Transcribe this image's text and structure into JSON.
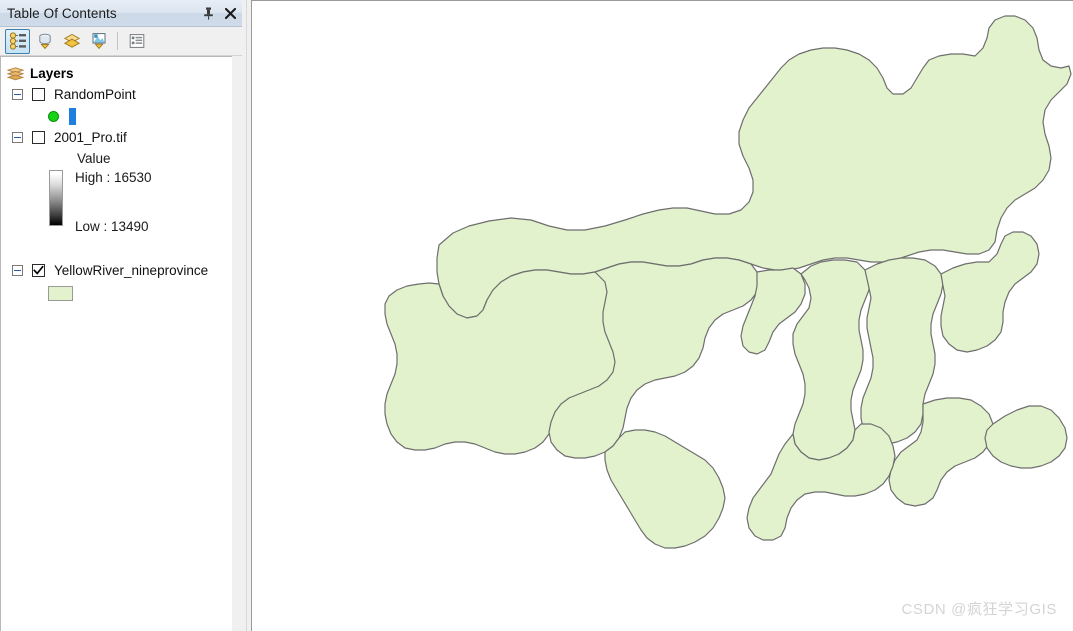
{
  "panel": {
    "title": "Table Of Contents",
    "title_buttons": [
      {
        "name": "auto-hide-pin",
        "icon": "pin-icon",
        "tooltip": "Auto Hide"
      },
      {
        "name": "close",
        "icon": "close-icon",
        "tooltip": "Close"
      }
    ],
    "toolbar": [
      {
        "name": "list-by-drawing-order",
        "icon": "list-by-drawing-order-icon",
        "active": true
      },
      {
        "name": "list-by-source",
        "icon": "list-by-source-icon",
        "active": false
      },
      {
        "name": "list-by-visibility",
        "icon": "list-by-visibility-icon",
        "active": false
      },
      {
        "name": "list-by-selection",
        "icon": "list-by-selection-icon",
        "active": false
      },
      {
        "name": "options",
        "icon": "options-icon",
        "active": false
      }
    ],
    "tree": {
      "root": {
        "label": "Layers",
        "icon": "layers-stack-icon",
        "expanded": true
      },
      "layers": [
        {
          "name": "RandomPoint",
          "label": "RandomPoint",
          "checked": false,
          "expanded": true,
          "type": "point",
          "symbols": [
            {
              "kind": "point",
              "color": "#16d316"
            },
            {
              "kind": "bar",
              "color": "#1f7fe0"
            }
          ]
        },
        {
          "name": "2001_Pro.tif",
          "label": "2001_Pro.tif",
          "checked": false,
          "expanded": true,
          "type": "raster",
          "legend": {
            "heading": "Value",
            "high_label": "High : 16530",
            "low_label": "Low : 13490",
            "high_value": 16530,
            "low_value": 13490,
            "ramp_top_color": "#ffffff",
            "ramp_bottom_color": "#000000"
          }
        },
        {
          "name": "YellowRiver_nineprovince",
          "label": "YellowRiver_nineprovince",
          "checked": true,
          "expanded": true,
          "type": "polygon",
          "symbols": [
            {
              "kind": "polygon",
              "fill": "#e2f2cd",
              "outline": "#9a9a9a"
            }
          ]
        }
      ]
    }
  },
  "map": {
    "background": "#ffffff",
    "fill_color": "#e2f2cd",
    "outline_color": "#6e6e6e",
    "watermark": "CSDN @疯狂学习GIS"
  }
}
